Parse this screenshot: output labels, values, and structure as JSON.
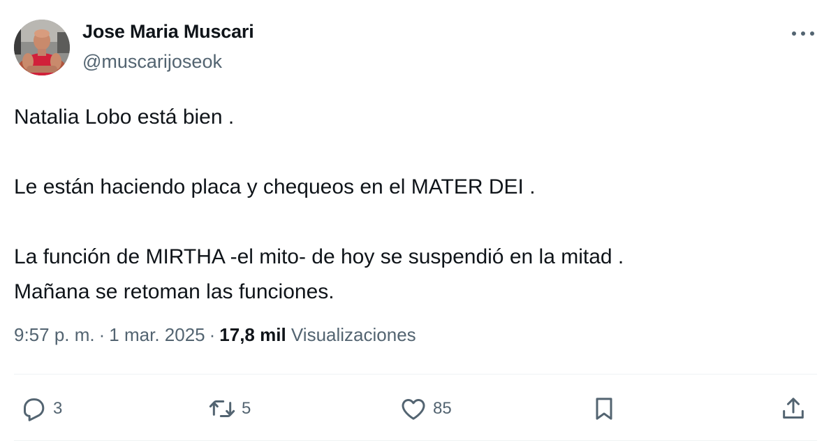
{
  "author": {
    "display_name": "Jose Maria Muscari",
    "handle": "@muscarijoseok"
  },
  "tweet": {
    "paragraphs": [
      "Natalia Lobo está bien .",
      "Le están haciendo placa y chequeos en el MATER DEI .",
      "La función de MIRTHA -el mito- de hoy se suspendió en la mitad .",
      "Mañana se retoman las funciones."
    ]
  },
  "meta": {
    "time": "9:57 p. m.",
    "date": "1 mar. 2025",
    "separator": "·",
    "views_count": "17,8 mil",
    "views_label": "Visualizaciones"
  },
  "actions": {
    "replies": "3",
    "retweets": "5",
    "likes": "85"
  },
  "icons": {
    "more": "more-horizontal-icon",
    "reply": "reply-bubble-icon",
    "retweet": "retweet-icon",
    "like": "heart-icon",
    "bookmark": "bookmark-icon",
    "share": "share-upload-icon"
  },
  "colors": {
    "text_primary": "#0f1419",
    "text_secondary": "#536471",
    "divider": "#eff3f4"
  }
}
